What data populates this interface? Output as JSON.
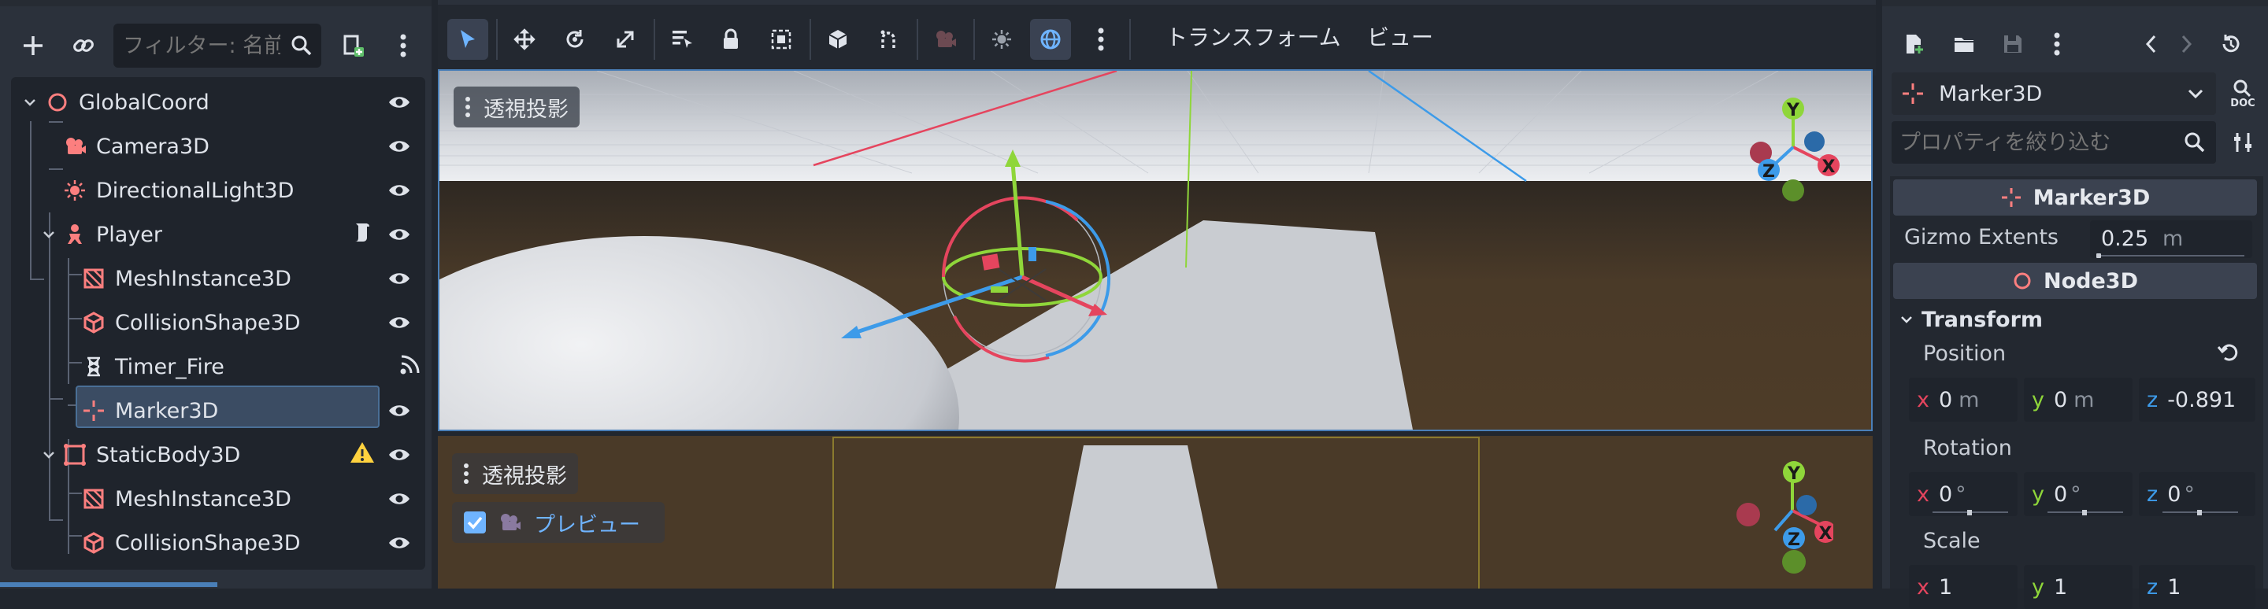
{
  "scene": {
    "filter_placeholder": "フィルター: 名前",
    "nodes": [
      {
        "label": "GlobalCoord"
      },
      {
        "label": "Camera3D"
      },
      {
        "label": "DirectionalLight3D"
      },
      {
        "label": "Player"
      },
      {
        "label": "MeshInstance3D"
      },
      {
        "label": "CollisionShape3D"
      },
      {
        "label": "Timer_Fire"
      },
      {
        "label": "Marker3D"
      },
      {
        "label": "StaticBody3D"
      },
      {
        "label": "MeshInstance3D"
      },
      {
        "label": "CollisionShape3D"
      }
    ]
  },
  "viewport": {
    "menu_transform": "トランスフォーム",
    "menu_view": "ビュー",
    "top_perspective": "透視投影",
    "bottom_perspective": "透視投影",
    "preview_label": "プレビュー",
    "preview_checked": true,
    "gizmo": {
      "y": "Y",
      "x": "X",
      "z": "Z"
    }
  },
  "inspector": {
    "node_name": "Marker3D",
    "filter_placeholder": "プロパティを絞り込む",
    "doc_label": "DOC",
    "section_marker": "Marker3D",
    "gizmo_extents_label": "Gizmo Extents",
    "gizmo_extents_value": "0.25",
    "gizmo_extents_unit": "m",
    "section_node3d": "Node3D",
    "group_transform": "Transform",
    "position_label": "Position",
    "position": {
      "x": "0",
      "y": "0",
      "z": "-0.891",
      "unit": "m"
    },
    "rotation_label": "Rotation",
    "rotation": {
      "x": "0",
      "y": "0",
      "z": "0",
      "unit": "°"
    },
    "scale_label": "Scale",
    "scale": {
      "x": "1",
      "y": "1",
      "z": "1"
    }
  },
  "colors": {
    "accent": "#4a7fb8",
    "axis_x": "#e5455e",
    "axis_y": "#8fd63a",
    "axis_z": "#3d9be9"
  }
}
